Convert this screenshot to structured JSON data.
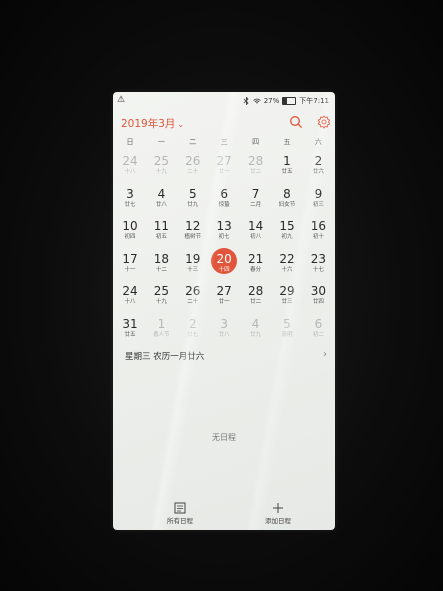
{
  "status_bar": {
    "warning": "⚠",
    "battery": "27%",
    "time": "下午7:11"
  },
  "header": {
    "month_title": "2019年3月",
    "chevron": "⌄"
  },
  "weekdays": [
    "日",
    "一",
    "二",
    "三",
    "四",
    "五",
    "六"
  ],
  "weeks": [
    [
      {
        "d": "24",
        "l": "十八",
        "other": true
      },
      {
        "d": "25",
        "l": "十九",
        "other": true
      },
      {
        "d": "26",
        "l": "二十",
        "other": true
      },
      {
        "d": "27",
        "l": "廿一",
        "other": true
      },
      {
        "d": "28",
        "l": "廿二",
        "other": true
      },
      {
        "d": "1",
        "l": "廿五"
      },
      {
        "d": "2",
        "l": "廿六"
      }
    ],
    [
      {
        "d": "3",
        "l": "廿七"
      },
      {
        "d": "4",
        "l": "廿八"
      },
      {
        "d": "5",
        "l": "廿九"
      },
      {
        "d": "6",
        "l": "惊蛰"
      },
      {
        "d": "7",
        "l": "二月"
      },
      {
        "d": "8",
        "l": "妇女节"
      },
      {
        "d": "9",
        "l": "初三"
      }
    ],
    [
      {
        "d": "10",
        "l": "初四"
      },
      {
        "d": "11",
        "l": "初五"
      },
      {
        "d": "12",
        "l": "植树节"
      },
      {
        "d": "13",
        "l": "初七"
      },
      {
        "d": "14",
        "l": "初八"
      },
      {
        "d": "15",
        "l": "初九"
      },
      {
        "d": "16",
        "l": "初十"
      }
    ],
    [
      {
        "d": "17",
        "l": "十一"
      },
      {
        "d": "18",
        "l": "十二"
      },
      {
        "d": "19",
        "l": "十三"
      },
      {
        "d": "20",
        "l": "十四",
        "today": true
      },
      {
        "d": "21",
        "l": "春分"
      },
      {
        "d": "22",
        "l": "十六"
      },
      {
        "d": "23",
        "l": "十七"
      }
    ],
    [
      {
        "d": "24",
        "l": "十八"
      },
      {
        "d": "25",
        "l": "十九"
      },
      {
        "d": "26",
        "l": "二十"
      },
      {
        "d": "27",
        "l": "廿一"
      },
      {
        "d": "28",
        "l": "廿二"
      },
      {
        "d": "29",
        "l": "廿三"
      },
      {
        "d": "30",
        "l": "廿四"
      }
    ],
    [
      {
        "d": "31",
        "l": "廿五"
      },
      {
        "d": "1",
        "l": "愚人节",
        "other": true
      },
      {
        "d": "2",
        "l": "廿七",
        "other": true
      },
      {
        "d": "3",
        "l": "廿八",
        "other": true
      },
      {
        "d": "4",
        "l": "廿九",
        "other": true
      },
      {
        "d": "5",
        "l": "清明",
        "other": true
      },
      {
        "d": "6",
        "l": "初二",
        "other": true
      }
    ]
  ],
  "selected_info": "星期三 农历一月廿六",
  "empty_state": "无日程",
  "bottom_bar": {
    "all_events": "所有日程",
    "add_event": "添加日程"
  },
  "colors": {
    "accent": "#e0553c"
  }
}
